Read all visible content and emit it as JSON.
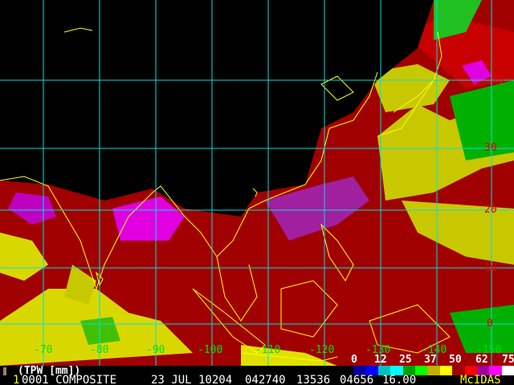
{
  "product": {
    "title": "(TPW [mm])",
    "frame": "1",
    "line": "0001 COMPOSITE",
    "date": "23 JUL 10204",
    "time": "042740",
    "elem": "13536",
    "line2": "04656",
    "res": "16.00",
    "logo": "McIDAS"
  },
  "longitude_labels": [
    "-70",
    "-80",
    "-90",
    "-100",
    "-110",
    "-120",
    "-130",
    "-140",
    "-150"
  ],
  "latitude_labels": [
    "40",
    "30",
    "20",
    "10",
    "0"
  ],
  "colorbar": {
    "labels": [
      "0",
      "12",
      "25",
      "37",
      "50",
      "62",
      "75"
    ],
    "colors": [
      "#0000a0",
      "#0000ff",
      "#00c0c0",
      "#00ffff",
      "#00a000",
      "#00ff00",
      "#c0b000",
      "#ffff00",
      "#a00000",
      "#ff0000",
      "#a000a0",
      "#ff00ff",
      "#ffffff"
    ]
  },
  "colors": {
    "grid": "#00e0e0",
    "coast": "#ffff00",
    "lon_label": "#00e000",
    "lat_label": "#e00000"
  }
}
